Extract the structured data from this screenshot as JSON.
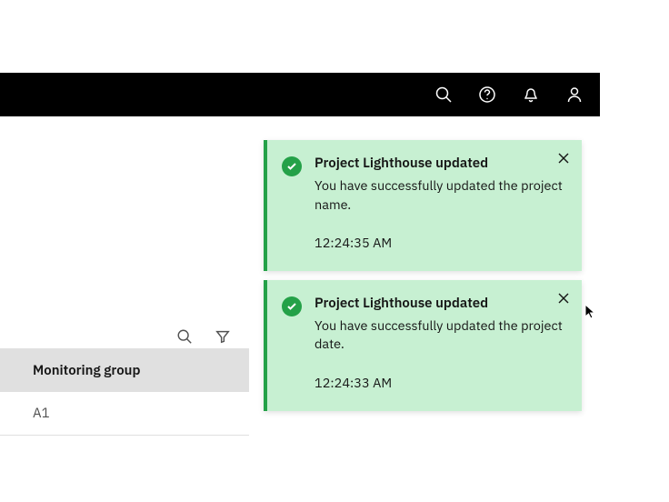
{
  "table": {
    "header": "Monitoring group",
    "rows": [
      "A1"
    ]
  },
  "toasts": [
    {
      "title": "Project Lighthouse updated",
      "message": "You have successfully updated the project name.",
      "time": "12:24:35 AM"
    },
    {
      "title": "Project Lighthouse updated",
      "message": "You have successfully updated the project date.",
      "time": "12:24:33 AM"
    }
  ]
}
